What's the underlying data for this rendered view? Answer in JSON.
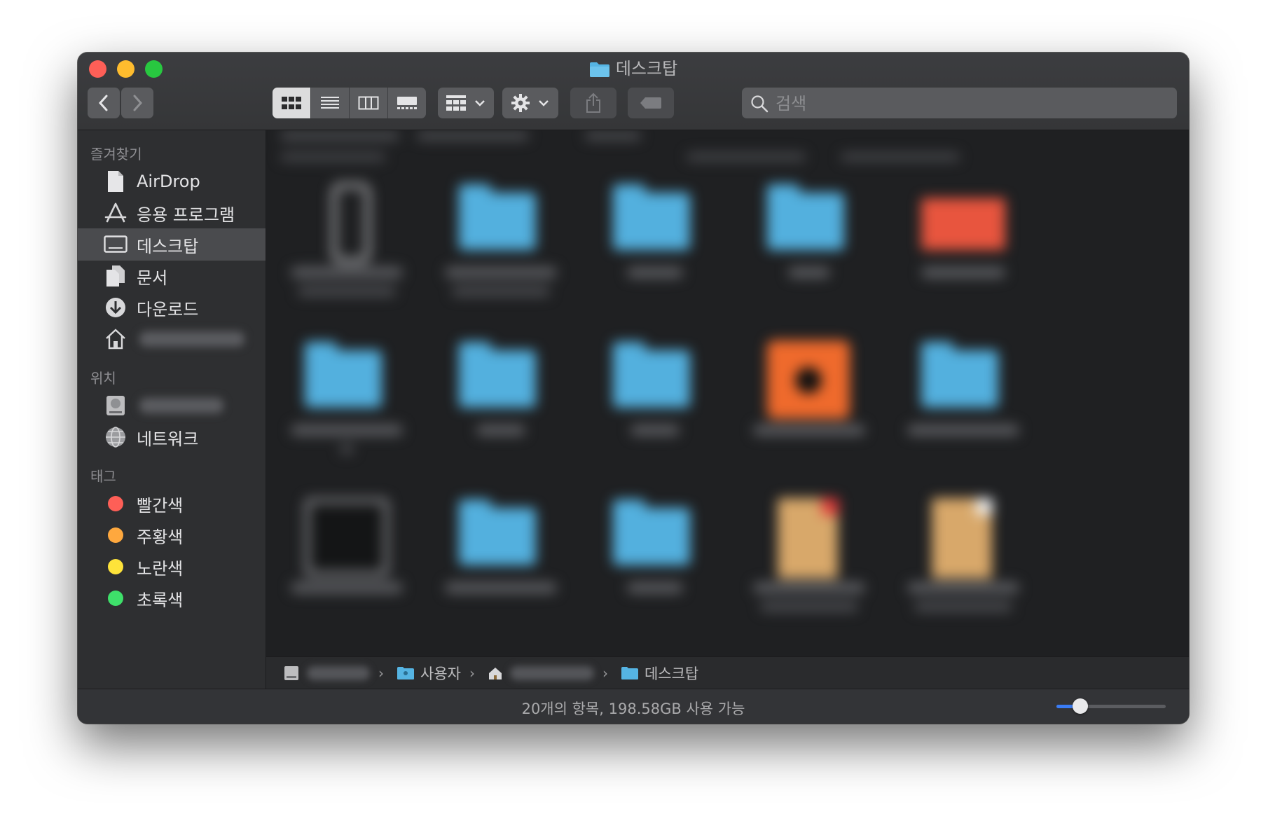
{
  "window": {
    "title": "데스크탑"
  },
  "toolbar": {
    "back_icon": "chevron-left-icon",
    "forward_icon": "chevron-right-icon",
    "search_placeholder": "검색"
  },
  "sidebar": {
    "favorites_header": "즐겨찾기",
    "favorites": [
      {
        "label": "AirDrop",
        "icon": "airdrop-icon"
      },
      {
        "label": "응용 프로그램",
        "icon": "applications-icon"
      },
      {
        "label": "데스크탑",
        "icon": "desktop-icon",
        "selected": true
      },
      {
        "label": "문서",
        "icon": "document-icon"
      },
      {
        "label": "다운로드",
        "icon": "download-icon"
      }
    ],
    "locations_header": "위치",
    "network_label": "네트워크",
    "tags_header": "태그",
    "tags": [
      {
        "label": "빨간색",
        "color": "#fe5f57"
      },
      {
        "label": "주황색",
        "color": "#fea83e"
      },
      {
        "label": "노란색",
        "color": "#fee33a"
      },
      {
        "label": "초록색",
        "color": "#3ee06a"
      }
    ]
  },
  "pathbar": {
    "users_label": "사용자",
    "desktop_label": "데스크탑"
  },
  "status": {
    "text": "20개의 항목, 198.58GB 사용 가능",
    "icon_size_fraction": 0.22
  }
}
